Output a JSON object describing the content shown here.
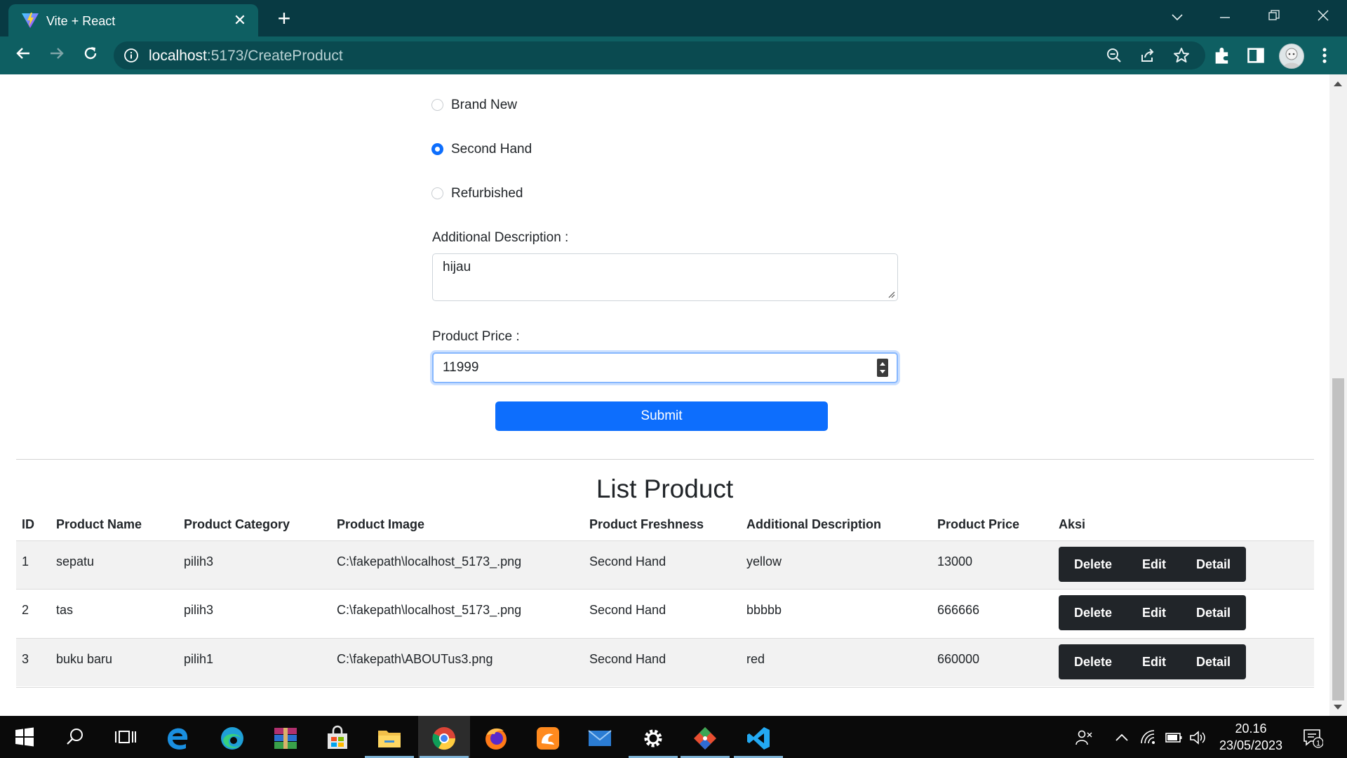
{
  "browser": {
    "tab_title": "Vite + React",
    "url_host": "localhost",
    "url_rest": ":5173/CreateProduct"
  },
  "form": {
    "freshness_options": [
      {
        "label": "Brand New",
        "checked": false
      },
      {
        "label": "Second Hand",
        "checked": true
      },
      {
        "label": "Refurbished",
        "checked": false
      }
    ],
    "description_label": "Additional Description :",
    "description_value": "hijau",
    "price_label": "Product Price :",
    "price_value": "11999",
    "submit_label": "Submit"
  },
  "list": {
    "title": "List Product",
    "columns": [
      "ID",
      "Product Name",
      "Product Category",
      "Product Image",
      "Product Freshness",
      "Additional Description",
      "Product Price",
      "Aksi"
    ],
    "rows": [
      {
        "id": "1",
        "name": "sepatu",
        "category": "pilih3",
        "image": "C:\\fakepath\\localhost_5173_.png",
        "freshness": "Second Hand",
        "description": "yellow",
        "price": "13000"
      },
      {
        "id": "2",
        "name": "tas",
        "category": "pilih3",
        "image": "C:\\fakepath\\localhost_5173_.png",
        "freshness": "Second Hand",
        "description": "bbbbb",
        "price": "666666"
      },
      {
        "id": "3",
        "name": "buku baru",
        "category": "pilih1",
        "image": "C:\\fakepath\\ABOUTus3.png",
        "freshness": "Second Hand",
        "description": "red",
        "price": "660000"
      }
    ],
    "actions": {
      "delete": "Delete",
      "edit": "Edit",
      "detail": "Detail"
    }
  },
  "taskbar": {
    "time": "20.16",
    "date": "23/05/2023",
    "notification_count": "1",
    "apps": [
      "start-icon",
      "search-icon",
      "task-view-icon",
      "edge-legacy-icon",
      "edge-icon",
      "winrar-icon",
      "store-icon",
      "file-explorer-icon",
      "chrome-icon",
      "firefox-icon",
      "uc-browser-icon",
      "mail-icon",
      "settings-icon",
      "git-icon",
      "vscode-icon"
    ]
  },
  "colors": {
    "primary": "#0d6efd",
    "dark_button": "#212529",
    "chrome_title": "#083a43",
    "chrome_toolbar": "#0e5f62"
  }
}
